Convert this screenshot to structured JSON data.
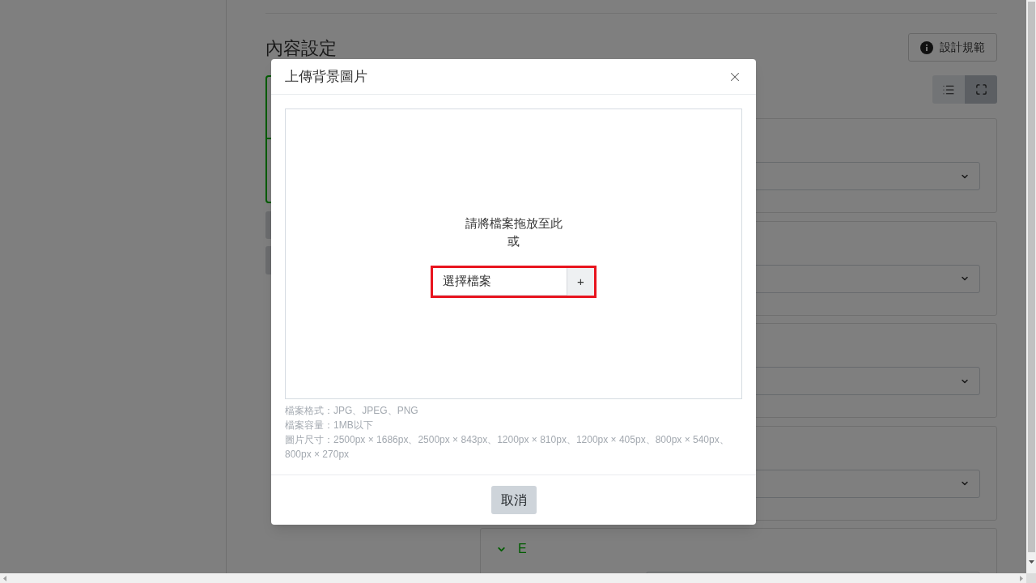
{
  "content_settings": {
    "heading": "內容設定",
    "guide_button": {
      "label": "設計規範"
    },
    "preview_card": {
      "active": true
    },
    "view_modes": [
      {
        "kind": "list",
        "selected": false
      },
      {
        "kind": "expand",
        "selected": true
      }
    ],
    "sections": [
      {
        "kind": "dropdown"
      },
      {
        "kind": "dropdown"
      },
      {
        "kind": "dropdown"
      },
      {
        "kind": "dropdown"
      },
      {
        "kind": "dropdown",
        "title": "E"
      }
    ]
  },
  "dialog": {
    "title": "上傳背景圖片",
    "dropzone": {
      "prompt": "請將檔案拖放至此",
      "separator": "或",
      "file_picker": {
        "label": "選擇檔案",
        "button": "+",
        "highlighted": true
      }
    },
    "notes": [
      "檔案格式：JPG、JPEG、PNG",
      "檔案容量：1MB以下",
      "圖片尺寸：2500px × 1686px、2500px × 843px、1200px × 810px、1200px × 405px、800px × 540px、800px × 270px"
    ],
    "buttons": [
      {
        "label": "取消"
      }
    ]
  }
}
